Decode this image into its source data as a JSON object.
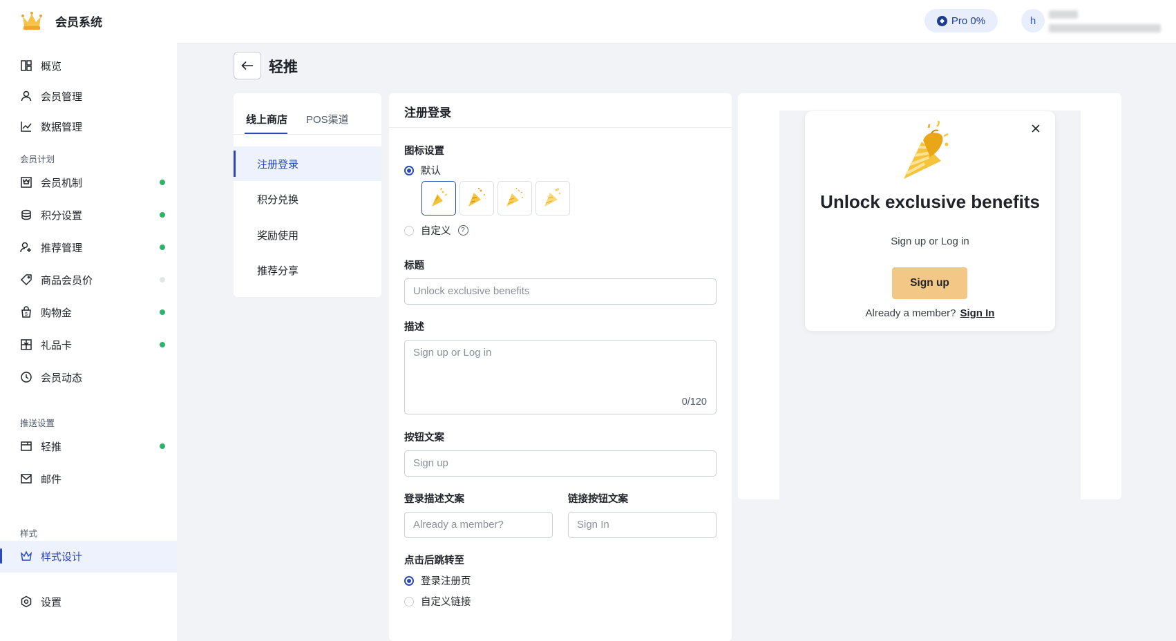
{
  "app": {
    "title": "会员系统",
    "plan_badge": "Pro 0%",
    "avatar_initial": "h"
  },
  "sidebar": {
    "top_items": [
      {
        "label": "概览",
        "icon": "dashboard-icon"
      },
      {
        "label": "会员管理",
        "icon": "user-icon"
      },
      {
        "label": "数据管理",
        "icon": "chart-icon"
      }
    ],
    "section_membership": "会员计划",
    "membership_items": [
      {
        "label": "会员机制",
        "icon": "member-card-icon",
        "status": "on"
      },
      {
        "label": "积分设置",
        "icon": "coins-icon",
        "status": "on"
      },
      {
        "label": "推荐管理",
        "icon": "user-plus-icon",
        "status": "on"
      },
      {
        "label": "商品会员价",
        "icon": "tag-icon",
        "status": "off"
      },
      {
        "label": "购物金",
        "icon": "bag-icon",
        "status": "on"
      },
      {
        "label": "礼品卡",
        "icon": "gift-card-icon",
        "status": "on"
      },
      {
        "label": "会员动态",
        "icon": "clock-icon"
      }
    ],
    "section_push": "推送设置",
    "push_items": [
      {
        "label": "轻推",
        "icon": "popup-icon",
        "status": "on"
      },
      {
        "label": "邮件",
        "icon": "mail-icon"
      }
    ],
    "section_style": "样式",
    "style_items": [
      {
        "label": "样式设计",
        "icon": "crown-icon",
        "active": true
      }
    ],
    "settings": {
      "label": "设置",
      "icon": "gear-icon"
    },
    "colors": {
      "status_on": "#2fb36b",
      "status_off": "#e5e6e8",
      "accent": "#2949b8"
    }
  },
  "page": {
    "title": "轻推"
  },
  "settings_nav": {
    "tabs": [
      "线上商店",
      "POS渠道"
    ],
    "active_tab": 0,
    "items": [
      "注册登录",
      "积分兑换",
      "奖励使用",
      "推荐分享"
    ],
    "active_item": 0
  },
  "form": {
    "heading": "注册登录",
    "icon_settings_label": "图标设置",
    "icon_default_label": "默认",
    "icon_custom_label": "自定义",
    "icon_options": [
      "party-popper-icon-1",
      "party-popper-icon-2",
      "party-popper-icon-3",
      "party-popper-icon-4"
    ],
    "title_label": "标题",
    "title_placeholder": "Unlock exclusive benefits",
    "desc_label": "描述",
    "desc_placeholder": "Sign up or Log in",
    "desc_counter": "0/120",
    "button_label": "按钮文案",
    "button_placeholder": "Sign up",
    "login_desc_label": "登录描述文案",
    "login_desc_placeholder": "Already a member?",
    "link_button_label": "链接按钮文案",
    "link_button_placeholder": "Sign In",
    "redirect_label": "点击后跳转至",
    "redirect_opt1": "登录注册页",
    "redirect_opt2": "自定义链接"
  },
  "preview": {
    "title": "Unlock exclusive benefits",
    "description": "Sign up or Log in",
    "button": "Sign up",
    "already": "Already a member?",
    "signin": "Sign In",
    "button_color": "#f3c785"
  }
}
